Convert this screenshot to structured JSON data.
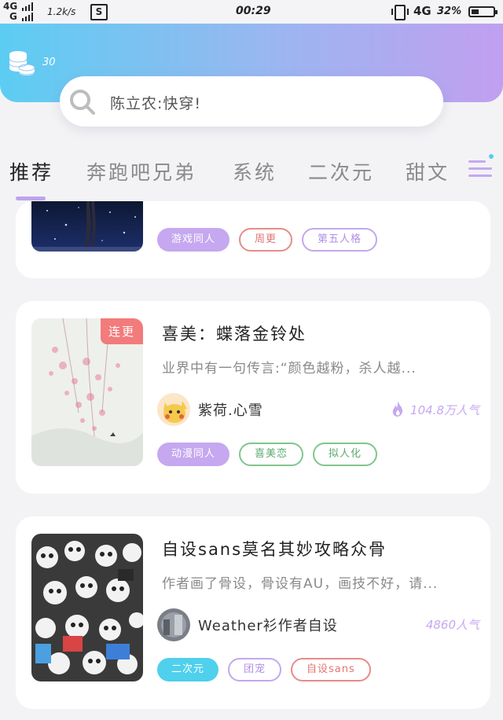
{
  "status_bar": {
    "network_1": "4G",
    "network_2": "G",
    "speed": "1.2k/s",
    "s_icon": "S",
    "time": "00:29",
    "network_type": "4G",
    "battery": "32%"
  },
  "header": {
    "coin_count": "30",
    "search_placeholder": "陈立农:快穿!"
  },
  "tabs": [
    "推荐",
    "奔跑吧兄弟",
    "系统",
    "二次元",
    "甜文"
  ],
  "cards": [
    {
      "tags": [
        "游戏同人",
        "周更",
        "第五人格"
      ]
    },
    {
      "badge": "连更",
      "title": "喜美：蝶落金铃处",
      "desc": "业界中有一句传言:“颜色越粉，杀人越...",
      "author": "紫荷.心雪",
      "popularity": "104.8万人气",
      "tags": [
        "动漫同人",
        "喜美恋",
        "拟人化"
      ]
    },
    {
      "title": "自设sans莫名其妙攻略众骨",
      "desc": "作者画了骨设，骨设有AU，画技不好，请...",
      "author": "Weather衫作者自设",
      "popularity": "4860人气",
      "tags": [
        "二次元",
        "团宠",
        "自设sans"
      ]
    }
  ],
  "colors": {
    "accent_purple": "#c5a8ef",
    "accent_cyan": "#4fd0ec",
    "badge_red": "#f27b7b",
    "tag_green": "#7fc68e"
  },
  "icons": [
    "signal-icon",
    "sim-icon",
    "vibrate-icon",
    "battery-icon",
    "coin-stack-icon",
    "search-icon",
    "menu-icon",
    "flame-icon"
  ]
}
